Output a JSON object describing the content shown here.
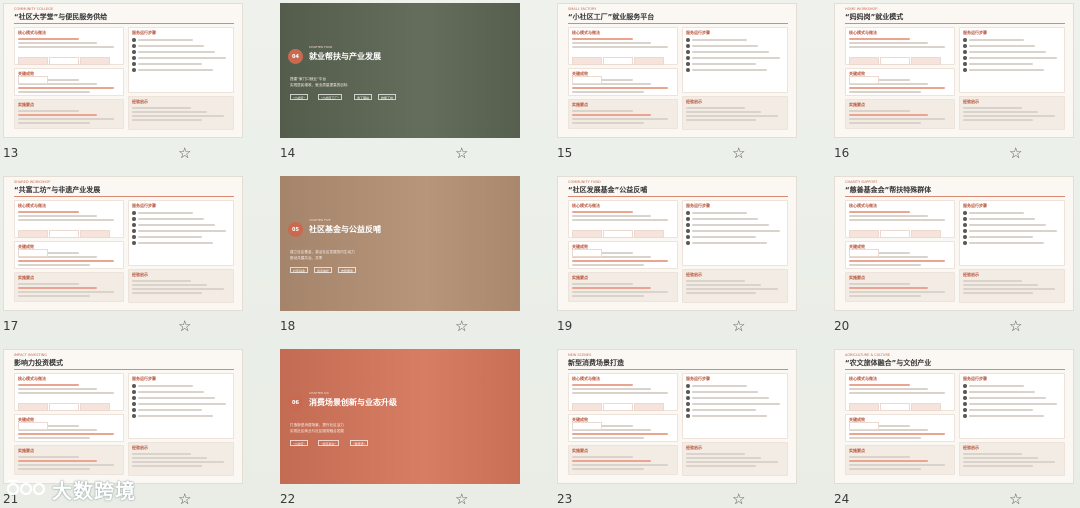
{
  "slides": [
    {
      "number": "13",
      "type": "content",
      "tag": "COMMUNITY COLLEGE",
      "title": "“社区大学堂”与便民服务供给",
      "box1": "核心模式与做法",
      "box2": "关键成效",
      "box3": "实施要点",
      "right_head": "服务运行步骤",
      "right_foot": "经验启示"
    },
    {
      "number": "14",
      "type": "section",
      "badge": "04",
      "chapter": "CHAPTER FOUR",
      "title": "就业帮扶与产业发展",
      "sub1": "搭建“家门口就业”平台",
      "sub2": "实现居民增收、就业质量提高的目标",
      "pills": [
        "“小社区”",
        "“小社区工厂”",
        "零工驿站",
        "技能工坊"
      ],
      "color": "#5b6452"
    },
    {
      "number": "15",
      "type": "content",
      "tag": "SMALL FACTORY",
      "title": "“小社区工厂”就业服务平台",
      "box1": "核心模式与做法",
      "box2": "关键成效",
      "box3": "实施要点",
      "right_head": "服务运行步骤",
      "right_foot": "经验启示"
    },
    {
      "number": "16",
      "type": "content",
      "tag": "HOME WORKSHOP",
      "title": "“妈妈岗”就业模式",
      "box1": "核心模式与做法",
      "box2": "关键成效",
      "box3": "实施要点",
      "right_head": "服务运行步骤",
      "right_foot": "经验启示"
    },
    {
      "number": "17",
      "type": "content",
      "tag": "SHARED WORKSHOP",
      "title": "“共富工坊”与非遗产业发展",
      "box1": "核心模式与做法",
      "box2": "关键成效",
      "box3": "实施要点",
      "right_head": "服务运行步骤",
      "right_foot": "经验启示"
    },
    {
      "number": "18",
      "type": "section",
      "badge": "05",
      "chapter": "CHAPTER FIVE",
      "title": "社区基金与公益反哺",
      "sub1": "建立社区基金，激活社区发展的内生动力",
      "sub2": "推动共建共治、共享",
      "pills": [
        "社区基金",
        "慈善信托",
        "志愿服务"
      ],
      "color": "#b28f73"
    },
    {
      "number": "19",
      "type": "content",
      "tag": "COMMUNITY FUND",
      "title": "“社区发展基金”公益反哺",
      "box1": "核心模式与做法",
      "box2": "关键成效",
      "box3": "实施要点",
      "right_head": "服务运行步骤",
      "right_foot": "经验启示"
    },
    {
      "number": "20",
      "type": "content",
      "tag": "CHARITY SUPPORT",
      "title": "“慈善基金会”帮扶特殊群体",
      "box1": "核心模式与做法",
      "box2": "关键成效",
      "box3": "实施要点",
      "right_head": "服务运行步骤",
      "right_foot": "经验启示"
    },
    {
      "number": "21",
      "type": "content",
      "tag": "IMPACT INVESTING",
      "title": "影响力投资模式",
      "box1": "核心模式与做法",
      "box2": "关键成效",
      "box3": "实施要点",
      "right_head": "服务运行步骤",
      "right_foot": "经验启示"
    },
    {
      "number": "22",
      "type": "section",
      "badge": "06",
      "chapter": "CHAPTER SIX",
      "title": "消费场景创新与业态升级",
      "sub1": "打造新型消费场景，提升社区活力",
      "sub2": "实现社区商业与社区服务融合发展",
      "pills": [
        "“小社区”",
        "“社区商业”",
        "“夜经济”"
      ],
      "color": "#d4755a"
    },
    {
      "number": "23",
      "type": "content",
      "tag": "NEW SCENES",
      "title": "新型消费场景打造",
      "box1": "核心模式与做法",
      "box2": "关键成效",
      "box3": "实施要点",
      "right_head": "服务运行步骤",
      "right_foot": "经验启示"
    },
    {
      "number": "24",
      "type": "content",
      "tag": "AGRICULTURE & CULTURE",
      "title": "“农文旅体融合”与文创产业",
      "box1": "核心模式与做法",
      "box2": "关键成效",
      "box3": "实施要点",
      "right_head": "服务运行步骤",
      "right_foot": "经验启示"
    }
  ],
  "watermark": {
    "text": "大数跨境"
  },
  "colors": {
    "accent": "#c96a50",
    "star": "#555555"
  }
}
